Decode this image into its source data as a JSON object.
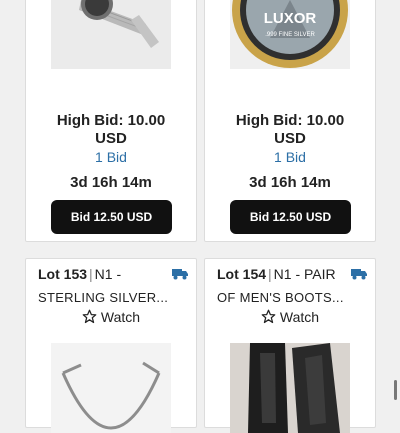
{
  "colors": {
    "accent_link": "#2c6fa6",
    "button_bg": "#111111",
    "truck_icon": "#2c6fa6"
  },
  "cards": [
    {
      "high_bid_label": "High Bid: 10.00",
      "currency": "USD",
      "bid_count": "1 Bid",
      "time_left": "3d 16h 14m",
      "bid_button": "Bid 12.50 USD",
      "image_icon": "wristwatch-image"
    },
    {
      "high_bid_label": "High Bid: 10.00",
      "currency": "USD",
      "bid_count": "1 Bid",
      "time_left": "3d 16h 14m",
      "bid_button": "Bid 12.50 USD",
      "image_icon": "coin-image",
      "coin_text": "LUXOR",
      "coin_subtext": ".999 FINE SILVER"
    },
    {
      "lot_number": "Lot 153",
      "lot_code": "N1 -",
      "title": "STERLING SILVER...",
      "watch_label": "Watch",
      "shipping_icon": "truck-icon",
      "image_icon": "necklace-image"
    },
    {
      "lot_number": "Lot 154",
      "lot_code": "N1 - PAIR",
      "title": "OF MEN'S BOOTS...",
      "watch_label": "Watch",
      "shipping_icon": "truck-icon",
      "image_icon": "boots-image"
    }
  ]
}
